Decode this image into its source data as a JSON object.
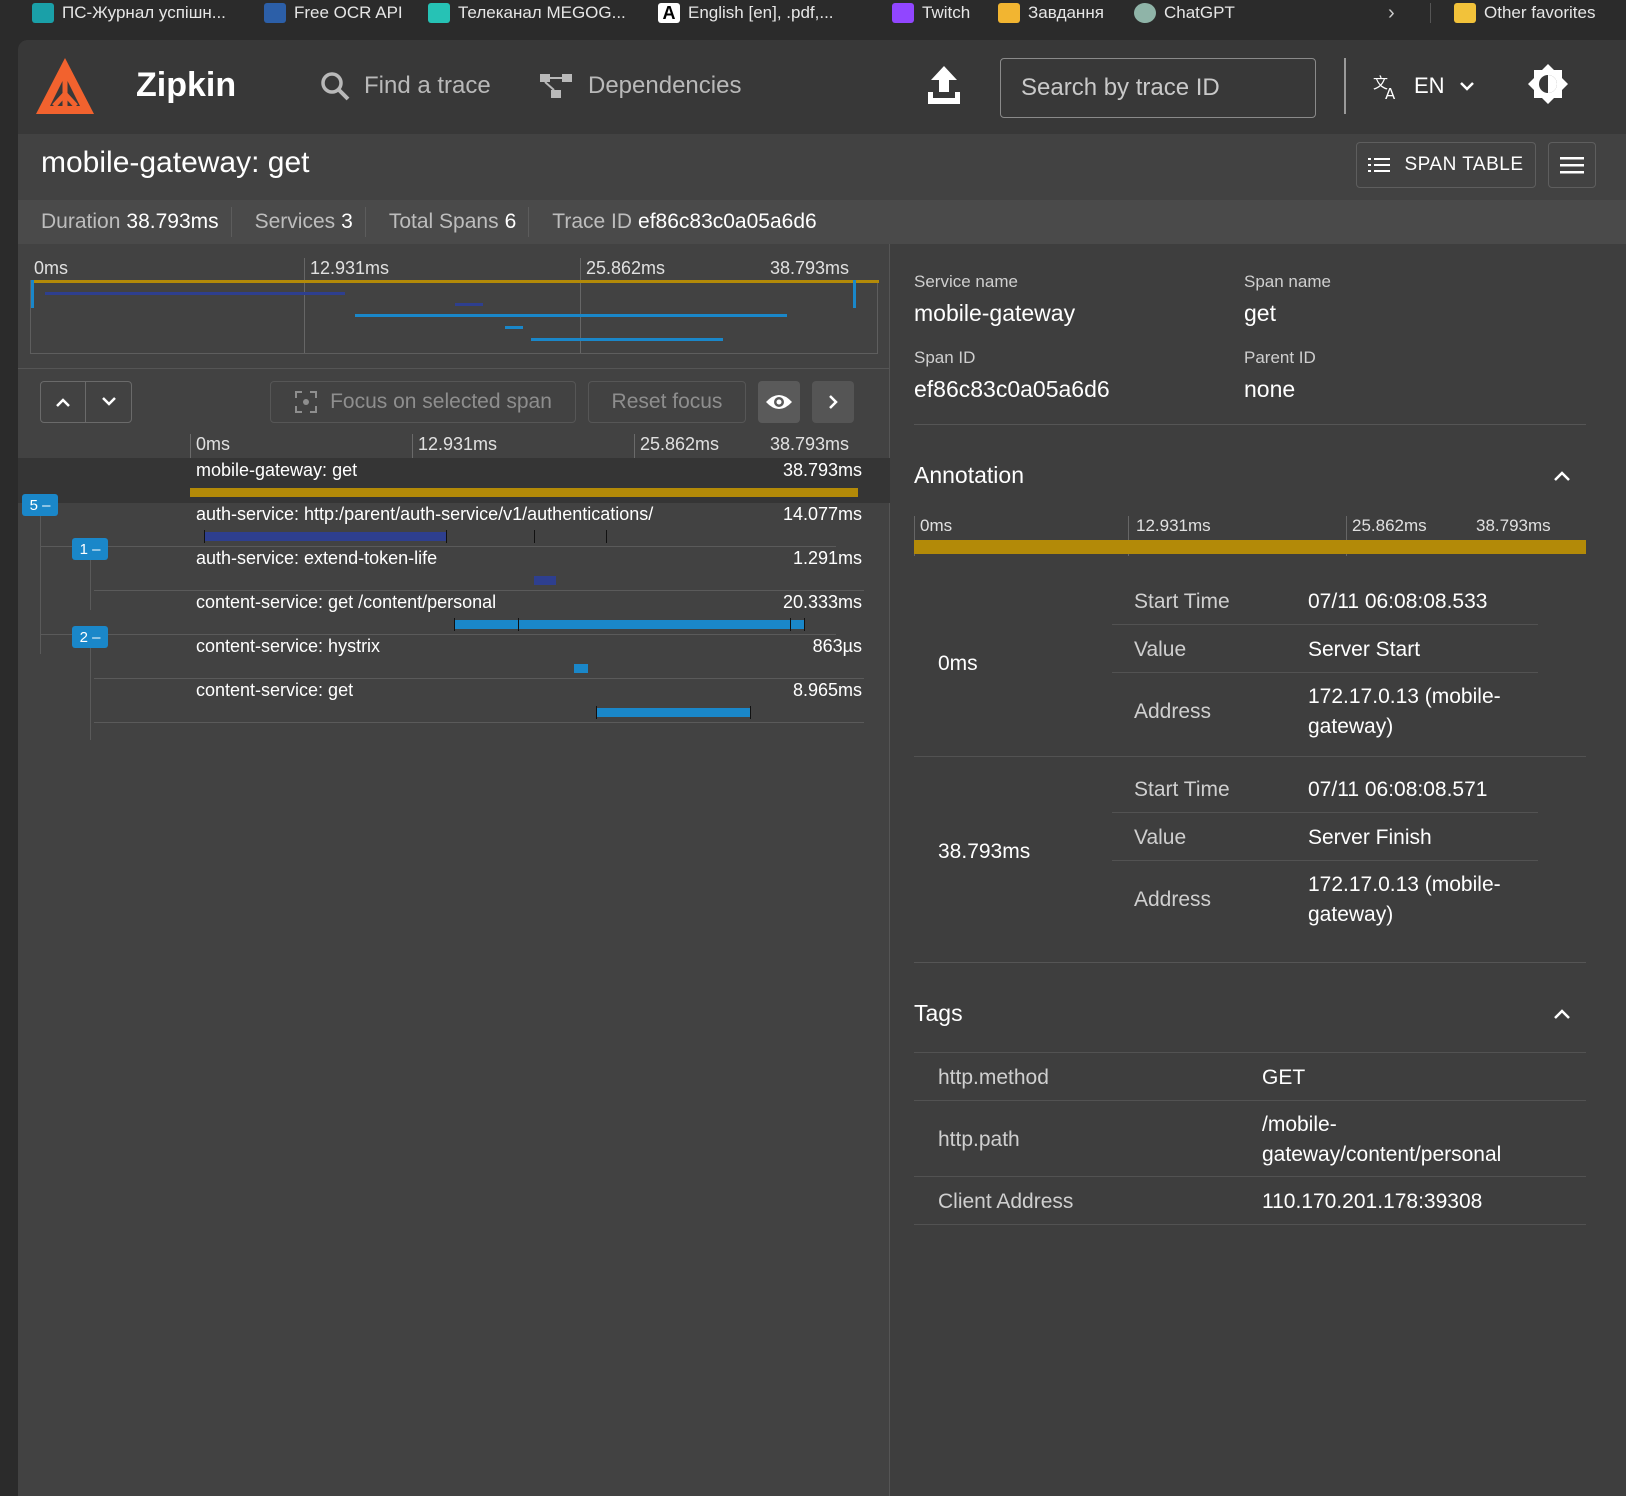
{
  "favorites": [
    {
      "label": "ПС-Журнал успішн...",
      "color": "#1aa0a8"
    },
    {
      "label": "Free OCR API",
      "color": "#2c5fa8"
    },
    {
      "label": "Телеканал MEGOG...",
      "color": "#26c2b5"
    },
    {
      "label": "English [en], .pdf,...",
      "color": "#ffffff"
    },
    {
      "label": "Twitch",
      "color": "#9146ff"
    },
    {
      "label": "Завдання",
      "color": "#f2b531"
    },
    {
      "label": "ChatGPT",
      "color": "#8fb4a8"
    }
  ],
  "favorites_other": "Other favorites",
  "app": {
    "brand": "Zipkin",
    "nav_find": "Find a trace",
    "nav_deps": "Dependencies",
    "search_placeholder": "Search by trace ID",
    "lang": "EN",
    "accent": "#f2622e"
  },
  "trace": {
    "title": "mobile-gateway: get",
    "span_table_label": "SPAN TABLE",
    "stats": [
      {
        "label": "Duration",
        "value": "38.793ms"
      },
      {
        "label": "Services",
        "value": "3"
      },
      {
        "label": "Total Spans",
        "value": "6"
      },
      {
        "label": "Trace ID",
        "value": "ef86c83c0a05a6d6"
      }
    ],
    "ticks": [
      "0ms",
      "12.931ms",
      "25.862ms",
      "38.793ms"
    ],
    "focus_label": "Focus on selected span",
    "reset_label": "Reset focus",
    "spans": [
      {
        "name": "mobile-gateway: get",
        "duration": "38.793ms",
        "color": "#b38a08"
      },
      {
        "name": "auth-service: http:/parent/auth-service/v1/authentications/",
        "duration": "14.077ms",
        "color": "#2e3f8f"
      },
      {
        "name": "auth-service: extend-token-life",
        "duration": "1.291ms",
        "color": "#2e3f8f"
      },
      {
        "name": "content-service: get /content/personal",
        "duration": "20.333ms",
        "color": "#1a87c9"
      },
      {
        "name": "content-service: hystrix",
        "duration": "863µs",
        "color": "#1a87c9"
      },
      {
        "name": "content-service: get",
        "duration": "8.965ms",
        "color": "#1a87c9"
      }
    ],
    "badges": [
      "5 –",
      "1 –",
      "2 –"
    ]
  },
  "detail": {
    "service_name_label": "Service name",
    "service_name": "mobile-gateway",
    "span_name_label": "Span name",
    "span_name": "get",
    "span_id_label": "Span ID",
    "span_id": "ef86c83c0a05a6d6",
    "parent_id_label": "Parent ID",
    "parent_id": "none",
    "annotation_title": "Annotation",
    "annotations": [
      {
        "time": "0ms",
        "start_label": "Start Time",
        "start": "07/11 06:08:08.533",
        "value_label": "Value",
        "value": "Server Start",
        "address_label": "Address",
        "address": "172.17.0.13 (mobile-gateway)"
      },
      {
        "time": "38.793ms",
        "start_label": "Start Time",
        "start": "07/11 06:08:08.571",
        "value_label": "Value",
        "value": "Server Finish",
        "address_label": "Address",
        "address": "172.17.0.13 (mobile-gateway)"
      }
    ],
    "tags_title": "Tags",
    "tags": [
      {
        "key": "http.method",
        "value": "GET"
      },
      {
        "key": "http.path",
        "value": "/mobile-gateway/content/personal"
      },
      {
        "key": "Client Address",
        "value": "110.170.201.178:39308"
      }
    ]
  }
}
